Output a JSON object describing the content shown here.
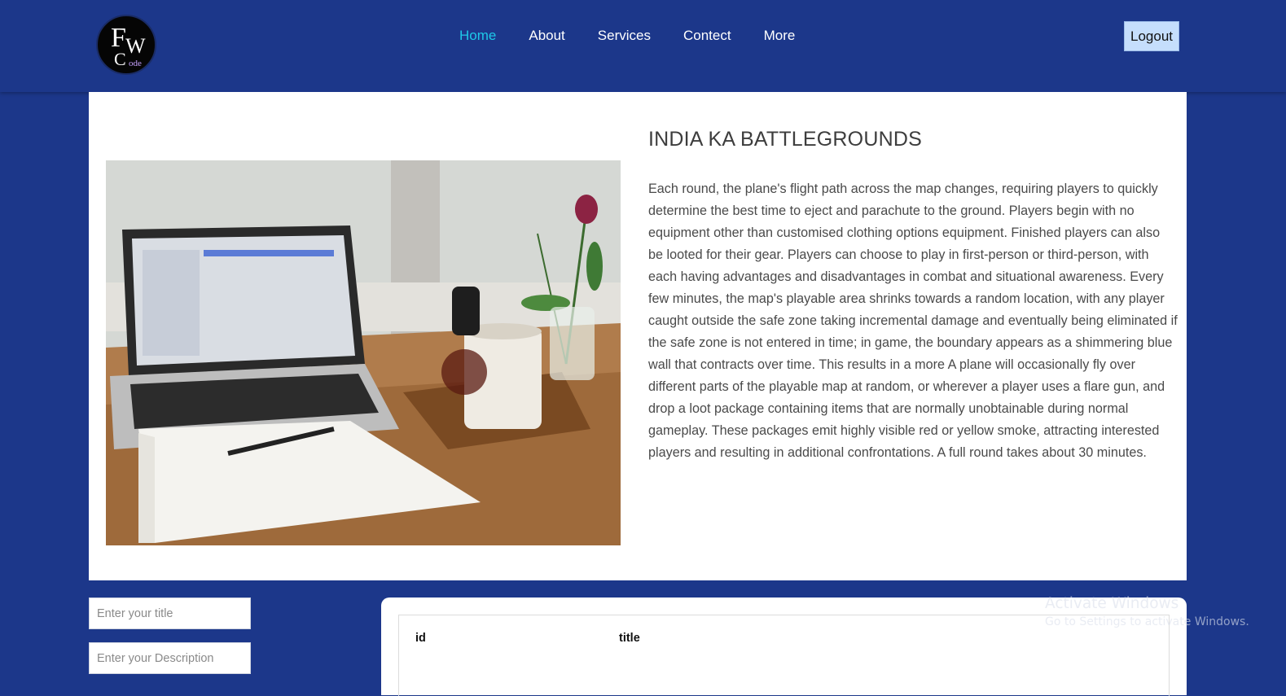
{
  "nav": {
    "logo_letters": [
      "F",
      "W",
      "C",
      "ode"
    ],
    "links": [
      {
        "label": "Home",
        "active": true
      },
      {
        "label": "About"
      },
      {
        "label": "Services"
      },
      {
        "label": "Contect"
      },
      {
        "label": "More"
      }
    ],
    "logout_label": "Logout"
  },
  "hero": {
    "title": "INDIA KA BATTLEGROUNDS",
    "body": "Each round, the plane's flight path across the map changes, requiring players to quickly determine the best time to eject and parachute to the ground. Players begin with no equipment other than customised clothing options equipment. Finished players can also be looted for their gear. Players can choose to play in first-person or third-person, with each having advantages and disadvantages in combat and situational awareness. Every few minutes, the map's playable area shrinks towards a random location, with any player caught outside the safe zone taking incremental damage and eventually being eliminated if the safe zone is not entered in time; in game, the boundary appears as a shimmering blue wall that contracts over time. This results in a more A plane will occasionally fly over different parts of the playable map at random, or wherever a player uses a flare gun, and drop a loot package containing items that are normally unobtainable during normal gameplay. These packages emit highly visible red or yellow smoke, attracting interested players and resulting in additional confrontations. A full round takes about 30 minutes."
  },
  "form": {
    "title_placeholder": "Enter your title",
    "description_placeholder": "Enter your Description"
  },
  "table": {
    "headers": [
      "id",
      "title"
    ]
  },
  "watermark": {
    "line1": "Activate Windows",
    "line2": "Go to Settings to activate Windows."
  },
  "colors": {
    "background": "#1c378a",
    "active_link": "#1ec8e8",
    "logout_bg": "#c5defc"
  }
}
